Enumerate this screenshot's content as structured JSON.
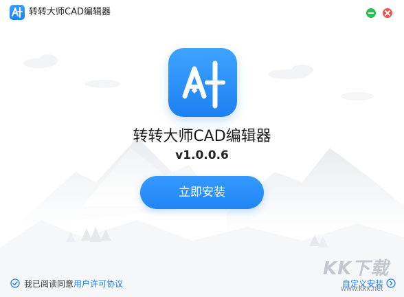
{
  "window": {
    "title": "转转大师CAD编辑器"
  },
  "app": {
    "name": "转转大师CAD编辑器",
    "version": "v1.0.0.6",
    "icon": "ai-pen-logo-icon"
  },
  "actions": {
    "install_label": "立即安装",
    "custom_install_label": "自定义安装"
  },
  "agreement": {
    "prefix": "我已阅读同意",
    "link_text": "用户许可协议",
    "checked": true
  },
  "watermark": {
    "logo_text": "KK下载",
    "url": "www.kkx.net"
  },
  "colors": {
    "accent": "#1f86f5",
    "minimize": "#27c24c",
    "close": "#f2524c",
    "text": "#1a1a1a"
  }
}
